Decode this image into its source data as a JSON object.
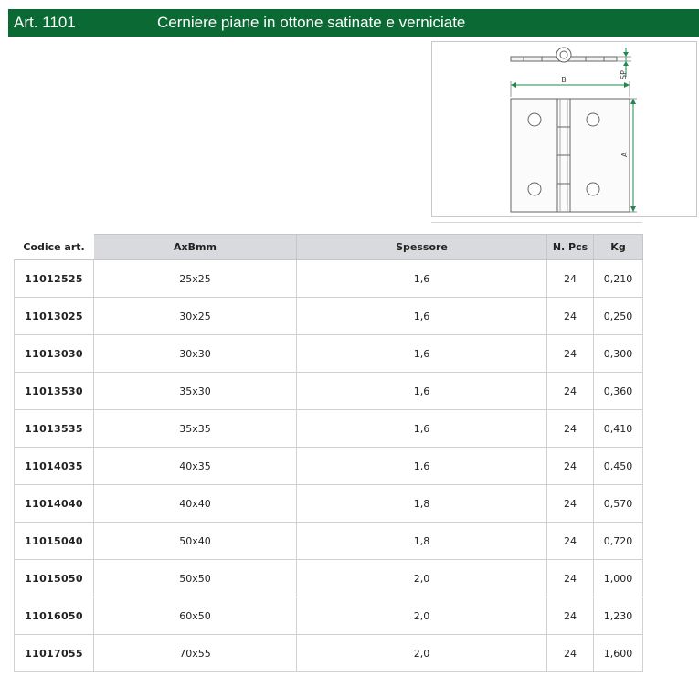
{
  "header": {
    "article": "Art. 1101",
    "title": "Cerniere piane in ottone satinate e verniciate"
  },
  "drawing": {
    "label_b": "B",
    "label_a": "A",
    "label_sp": "SP"
  },
  "table": {
    "headers": {
      "code": "Codice art.",
      "size": "AxBmm",
      "thickness": "Spessore",
      "pcs": "N. Pcs",
      "kg": "Kg"
    },
    "rows": [
      {
        "code": "11012525",
        "size": "25x25",
        "thickness": "1,6",
        "pcs": "24",
        "kg": "0,210"
      },
      {
        "code": "11013025",
        "size": "30x25",
        "thickness": "1,6",
        "pcs": "24",
        "kg": "0,250"
      },
      {
        "code": "11013030",
        "size": "30x30",
        "thickness": "1,6",
        "pcs": "24",
        "kg": "0,300"
      },
      {
        "code": "11013530",
        "size": "35x30",
        "thickness": "1,6",
        "pcs": "24",
        "kg": "0,360"
      },
      {
        "code": "11013535",
        "size": "35x35",
        "thickness": "1,6",
        "pcs": "24",
        "kg": "0,410"
      },
      {
        "code": "11014035",
        "size": "40x35",
        "thickness": "1,6",
        "pcs": "24",
        "kg": "0,450"
      },
      {
        "code": "11014040",
        "size": "40x40",
        "thickness": "1,8",
        "pcs": "24",
        "kg": "0,570"
      },
      {
        "code": "11015040",
        "size": "50x40",
        "thickness": "1,8",
        "pcs": "24",
        "kg": "0,720"
      },
      {
        "code": "11015050",
        "size": "50x50",
        "thickness": "2,0",
        "pcs": "24",
        "kg": "1,000"
      },
      {
        "code": "11016050",
        "size": "60x50",
        "thickness": "2,0",
        "pcs": "24",
        "kg": "1,230"
      },
      {
        "code": "11017055",
        "size": "70x55",
        "thickness": "2,0",
        "pcs": "24",
        "kg": "1,600"
      }
    ]
  },
  "colors": {
    "header_bg": "#0b6a34",
    "header_text": "#ffffff",
    "table_header_bg": "#d9dadd",
    "dimension_lines": "#1f8a4c"
  }
}
